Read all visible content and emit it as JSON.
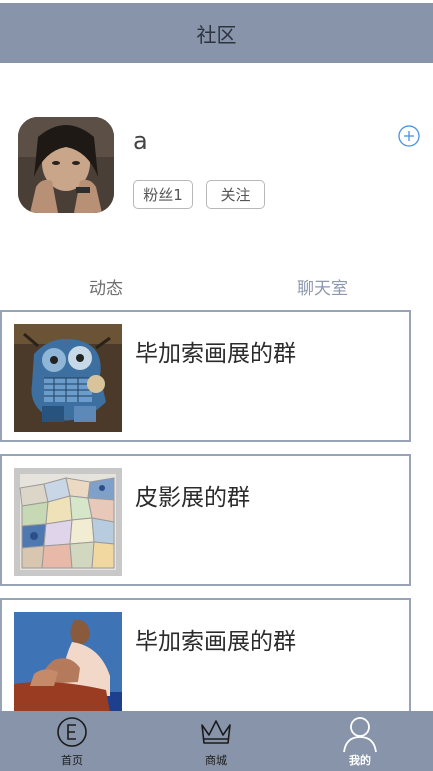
{
  "header": {
    "title": "社区"
  },
  "profile": {
    "username": "a",
    "fans_label": "粉丝1",
    "follow_label": "关注"
  },
  "tabs": [
    {
      "label": "动态",
      "active": false
    },
    {
      "label": "聊天室",
      "active": true
    }
  ],
  "groups": [
    {
      "name": "毕加索画展的群",
      "image": "cubist-painting"
    },
    {
      "name": "皮影展的群",
      "image": "ceramic-mosaic"
    },
    {
      "name": "毕加索画展的群",
      "image": "seated-figure-painting"
    }
  ],
  "tabbar": [
    {
      "label": "首页",
      "icon": "home-e-icon",
      "active": false
    },
    {
      "label": "商城",
      "icon": "crown-icon",
      "active": false
    },
    {
      "label": "我的",
      "icon": "user-icon",
      "active": true
    }
  ],
  "colors": {
    "header_bg": "#8794a9",
    "card_border": "#98a3b6",
    "accent": "#4a90e2",
    "active_tab": "#8c98ae"
  }
}
